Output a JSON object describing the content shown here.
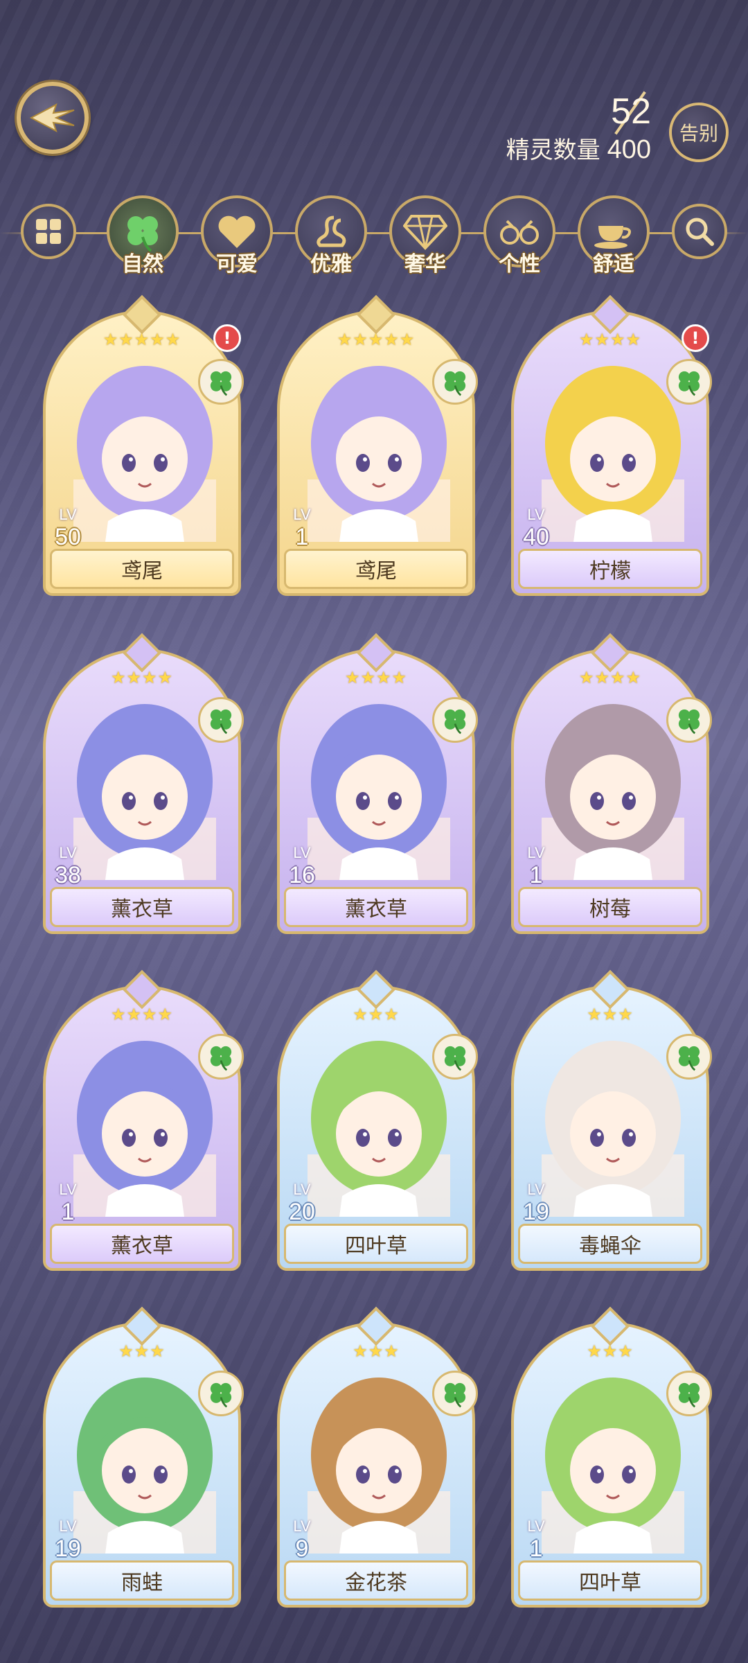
{
  "header": {
    "owned_count": "52",
    "count_label": "精灵数量",
    "capacity": "400",
    "farewell_label": "告别"
  },
  "filters": [
    {
      "label": "",
      "icon": "grid-icon"
    },
    {
      "label": "自然",
      "icon": "clover-icon"
    },
    {
      "label": "可爱",
      "icon": "heart-icon"
    },
    {
      "label": "优雅",
      "icon": "swan-icon"
    },
    {
      "label": "奢华",
      "icon": "diamond-icon"
    },
    {
      "label": "个性",
      "icon": "glasses-icon"
    },
    {
      "label": "舒适",
      "icon": "teacup-icon"
    },
    {
      "label": "",
      "icon": "search-icon"
    }
  ],
  "cards": [
    {
      "name": "鸢尾",
      "level": "50",
      "stars": "★★★★★",
      "rarity": "gold",
      "alert": true,
      "hair": "#b7a6ee",
      "skin": "#fff0e4"
    },
    {
      "name": "鸢尾",
      "level": "1",
      "stars": "★★★★★",
      "rarity": "gold",
      "alert": false,
      "hair": "#b7a6ee",
      "skin": "#fff0e4"
    },
    {
      "name": "柠檬",
      "level": "40",
      "stars": "★★★★",
      "rarity": "purple",
      "alert": true,
      "hair": "#f3d14c",
      "skin": "#fff0e4"
    },
    {
      "name": "薰衣草",
      "level": "38",
      "stars": "★★★★",
      "rarity": "purple",
      "alert": false,
      "hair": "#8c8fe4",
      "skin": "#fff0e4"
    },
    {
      "name": "薰衣草",
      "level": "16",
      "stars": "★★★★",
      "rarity": "purple",
      "alert": false,
      "hair": "#8c8fe4",
      "skin": "#fff0e4"
    },
    {
      "name": "树莓",
      "level": "1",
      "stars": "★★★★",
      "rarity": "purple",
      "alert": false,
      "hair": "#b09aa8",
      "skin": "#fff0e4"
    },
    {
      "name": "薰衣草",
      "level": "1",
      "stars": "★★★★",
      "rarity": "purple",
      "alert": false,
      "hair": "#8c8fe4",
      "skin": "#fff0e4"
    },
    {
      "name": "四叶草",
      "level": "20",
      "stars": "★★★",
      "rarity": "blue",
      "alert": false,
      "hair": "#9ed46c",
      "skin": "#fff0e4"
    },
    {
      "name": "毒蝇伞",
      "level": "19",
      "stars": "★★★",
      "rarity": "blue",
      "alert": false,
      "hair": "#efe7e2",
      "skin": "#fff0e4"
    },
    {
      "name": "雨蛙",
      "level": "19",
      "stars": "★★★",
      "rarity": "blue",
      "alert": false,
      "hair": "#6fc077",
      "skin": "#fff0e4"
    },
    {
      "name": "金花茶",
      "level": "9",
      "stars": "★★★",
      "rarity": "blue",
      "alert": false,
      "hair": "#c79258",
      "skin": "#fff0e4"
    },
    {
      "name": "四叶草",
      "level": "1",
      "stars": "★★★",
      "rarity": "blue",
      "alert": false,
      "hair": "#9ed46c",
      "skin": "#fff0e4"
    }
  ],
  "labels": {
    "lv": "LV",
    "alert_mark": "!"
  }
}
